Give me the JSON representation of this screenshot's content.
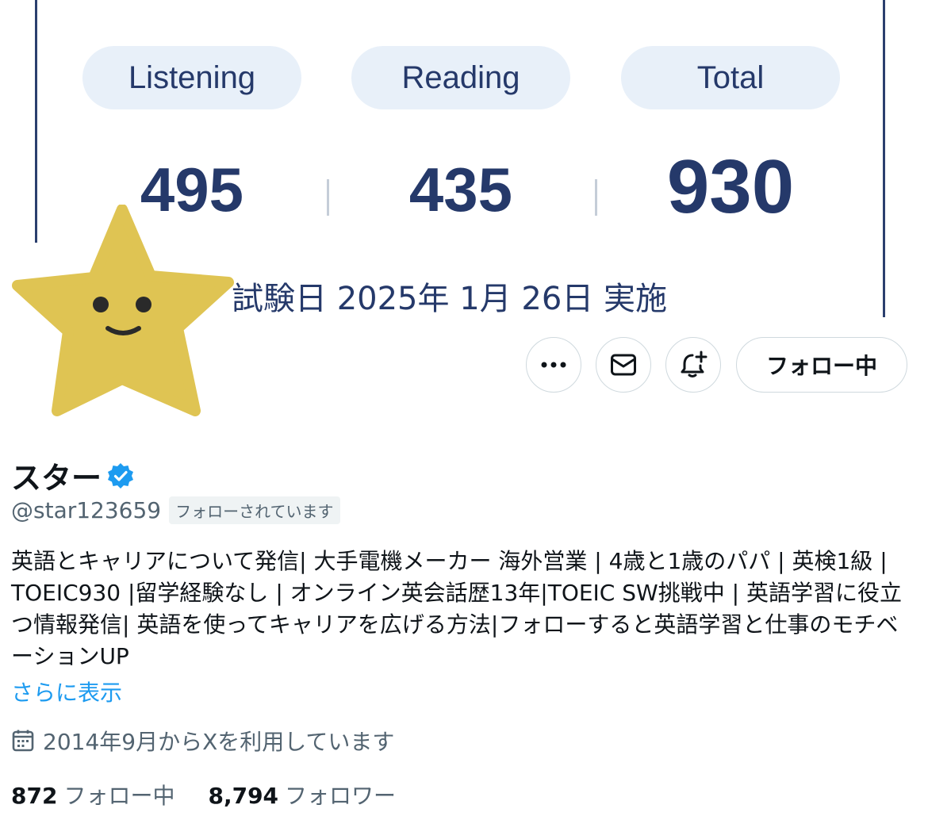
{
  "banner": {
    "labels": {
      "listening": "Listening",
      "reading": "Reading",
      "total": "Total"
    },
    "scores": {
      "listening": "495",
      "reading": "435",
      "total": "930"
    },
    "exam_date": "試験日 2025年 1月 26日 実施",
    "colors": {
      "primary": "#25396a",
      "pill": "#e8f0f9"
    }
  },
  "avatar": {
    "icon": "star-smiley-avatar",
    "color": "#dfc453"
  },
  "actions": {
    "more_icon": "more-horizontal-icon",
    "message_icon": "envelope-icon",
    "notify_icon": "bell-plus-icon",
    "follow_label": "フォロー中"
  },
  "profile": {
    "display_name": "スター",
    "verified_icon": "verified-badge-icon",
    "handle": "@star123659",
    "follows_you": "フォローされています",
    "bio": "英語とキャリアについて発信| 大手電機メーカー 海外営業 | 4歳と1歳のパパ | 英検1級 | TOEIC930 |留学経験なし | オンライン英会話歴13年|TOEIC SW挑戦中 | 英語学習に役立つ情報発信| 英語を使ってキャリアを広げる方法|フォローすると英語学習と仕事のモチベーションUP",
    "show_more": "さらに表示",
    "joined_icon": "calendar-icon",
    "joined": "2014年9月からXを利用しています",
    "following_count": "872",
    "following_label": "フォロー中",
    "followers_count": "8,794",
    "followers_label": "フォロワー"
  },
  "colors": {
    "link": "#1d9bf0",
    "secondary_text": "#536471",
    "verified": "#1d9bf0"
  }
}
